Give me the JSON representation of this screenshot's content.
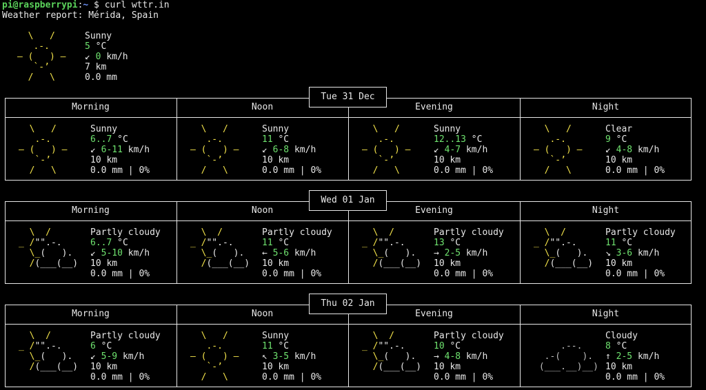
{
  "terminal": {
    "user": "pi@raspberrypi",
    "path": "~",
    "command": "curl wttr.in",
    "report_title": "Weather report: Mérida, Spain"
  },
  "current": {
    "condition": "Sunny",
    "temp": "5",
    "temp_unit": "°C",
    "wind_dir": "↙",
    "wind": "0",
    "wind_unit": "km/h",
    "visibility": "7 km",
    "precip": "0.0 mm"
  },
  "periods": [
    "Morning",
    "Noon",
    "Evening",
    "Night"
  ],
  "days": [
    {
      "label": "Tue 31 Dec",
      "cells": [
        {
          "art": "sunny",
          "condition": "Sunny",
          "temp": "6..7",
          "wind_dir": "↙",
          "wind": "6-11",
          "visibility": "10 km",
          "precip": "0.0 mm | 0%"
        },
        {
          "art": "sunny",
          "condition": "Sunny",
          "temp": "11",
          "wind_dir": "↙",
          "wind": "6-8",
          "visibility": "10 km",
          "precip": "0.0 mm | 0%"
        },
        {
          "art": "sunny",
          "condition": "Sunny",
          "temp": "12..13",
          "wind_dir": "↙",
          "wind": "4-7",
          "visibility": "10 km",
          "precip": "0.0 mm | 0%"
        },
        {
          "art": "sunny",
          "condition": "Clear",
          "temp": "9",
          "wind_dir": "↙",
          "wind": "4-8",
          "visibility": "10 km",
          "precip": "0.0 mm | 0%"
        }
      ]
    },
    {
      "label": "Wed 01 Jan",
      "cells": [
        {
          "art": "partly",
          "condition": "Partly cloudy",
          "temp": "6..7",
          "wind_dir": "↙",
          "wind": "5-10",
          "visibility": "10 km",
          "precip": "0.0 mm | 0%"
        },
        {
          "art": "partly",
          "condition": "Partly cloudy",
          "temp": "11",
          "wind_dir": "←",
          "wind": "5-6",
          "visibility": "10 km",
          "precip": "0.0 mm | 0%"
        },
        {
          "art": "partly",
          "condition": "Partly cloudy",
          "temp": "13",
          "wind_dir": "→",
          "wind": "2-5",
          "visibility": "10 km",
          "precip": "0.0 mm | 0%"
        },
        {
          "art": "partly",
          "condition": "Partly cloudy",
          "temp": "11",
          "wind_dir": "↘",
          "wind": "3-6",
          "visibility": "10 km",
          "precip": "0.0 mm | 0%"
        }
      ]
    },
    {
      "label": "Thu 02 Jan",
      "cells": [
        {
          "art": "partly",
          "condition": "Partly cloudy",
          "temp": "6",
          "wind_dir": "↙",
          "wind": "5-9",
          "visibility": "10 km",
          "precip": "0.0 mm | 0%"
        },
        {
          "art": "sunny",
          "condition": "Sunny",
          "temp": "11",
          "wind_dir": "↖",
          "wind": "3-5",
          "visibility": "10 km",
          "precip": "0.0 mm | 0%"
        },
        {
          "art": "partly",
          "condition": "Partly cloudy",
          "temp": "10",
          "wind_dir": "→",
          "wind": "4-8",
          "visibility": "10 km",
          "precip": "0.0 mm | 0%"
        },
        {
          "art": "cloudy",
          "condition": "Cloudy",
          "temp": "8",
          "wind_dir": "↑",
          "wind": "2-5",
          "visibility": "10 km",
          "precip": "0.0 mm | 0%"
        }
      ]
    }
  ],
  "units": {
    "temp": "°C",
    "wind": "km/h"
  },
  "colors": {
    "sun": "#f2e24a",
    "value": "#6fe36f",
    "text": "#e8e8e8",
    "prompt_user": "#5bd35b",
    "prompt_path": "#6a8ff5"
  }
}
